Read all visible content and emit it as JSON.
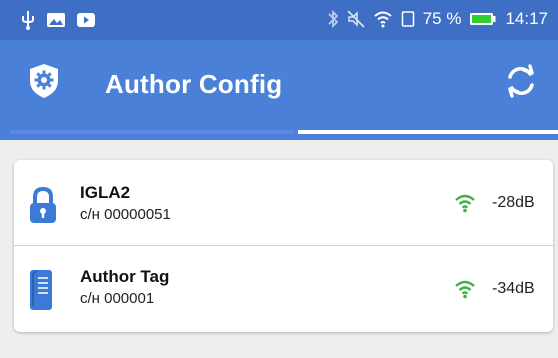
{
  "status_bar": {
    "battery_text": "75 %",
    "time": "14:17"
  },
  "app_bar": {
    "title": "Author Config"
  },
  "devices": [
    {
      "name": "IGLA2",
      "serial": "с/н 00000051",
      "rssi": "-28dB",
      "icon": "lock-icon"
    },
    {
      "name": "Author Tag",
      "serial": "с/н 000001",
      "rssi": "-34dB",
      "icon": "tag-device-icon"
    }
  ],
  "colors": {
    "status_bar": "#3f6fc4",
    "app_bar": "#4a80d8",
    "signal": "#3cb043",
    "icon_blue": "#3d7ad8"
  }
}
